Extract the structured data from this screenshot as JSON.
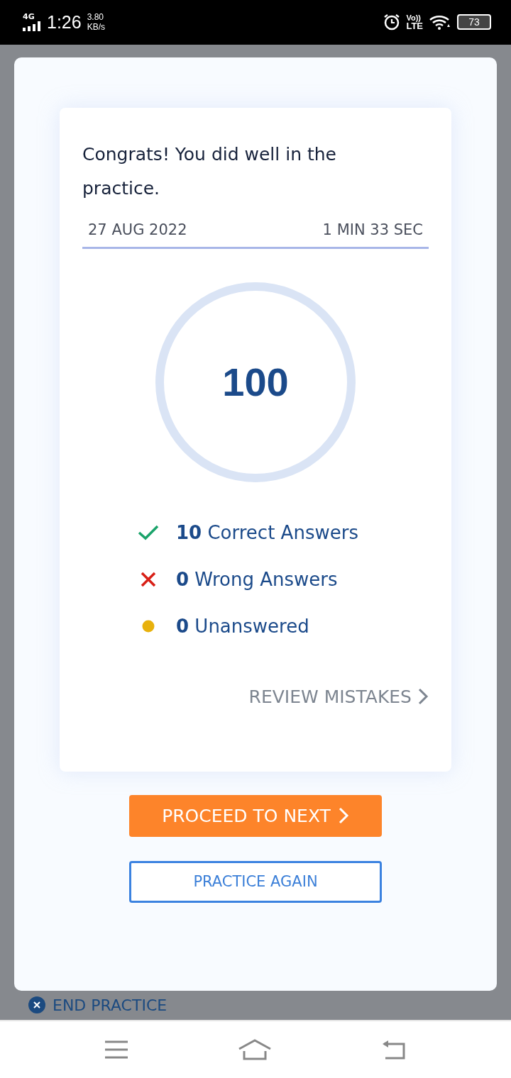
{
  "status_bar": {
    "network": "4G",
    "time": "1:26",
    "speed": "3.80",
    "speed_unit": "KB/s",
    "volte": "Vo))",
    "lte": "LTE",
    "battery": "73"
  },
  "result": {
    "message": "Congrats! You did well in the practice.",
    "date": "27 AUG 2022",
    "duration": "1 MIN 33 SEC",
    "score": "100",
    "stats": [
      {
        "kind": "correct",
        "count": "10",
        "label": "Correct Answers"
      },
      {
        "kind": "wrong",
        "count": "0",
        "label": "Wrong Answers"
      },
      {
        "kind": "unanswered",
        "count": "0",
        "label": "Unanswered"
      }
    ],
    "review_link": "REVIEW MISTAKES"
  },
  "buttons": {
    "proceed": "PROCEED TO NEXT",
    "again": "PRACTICE AGAIN"
  },
  "background": {
    "end_practice": "END PRACTICE"
  }
}
